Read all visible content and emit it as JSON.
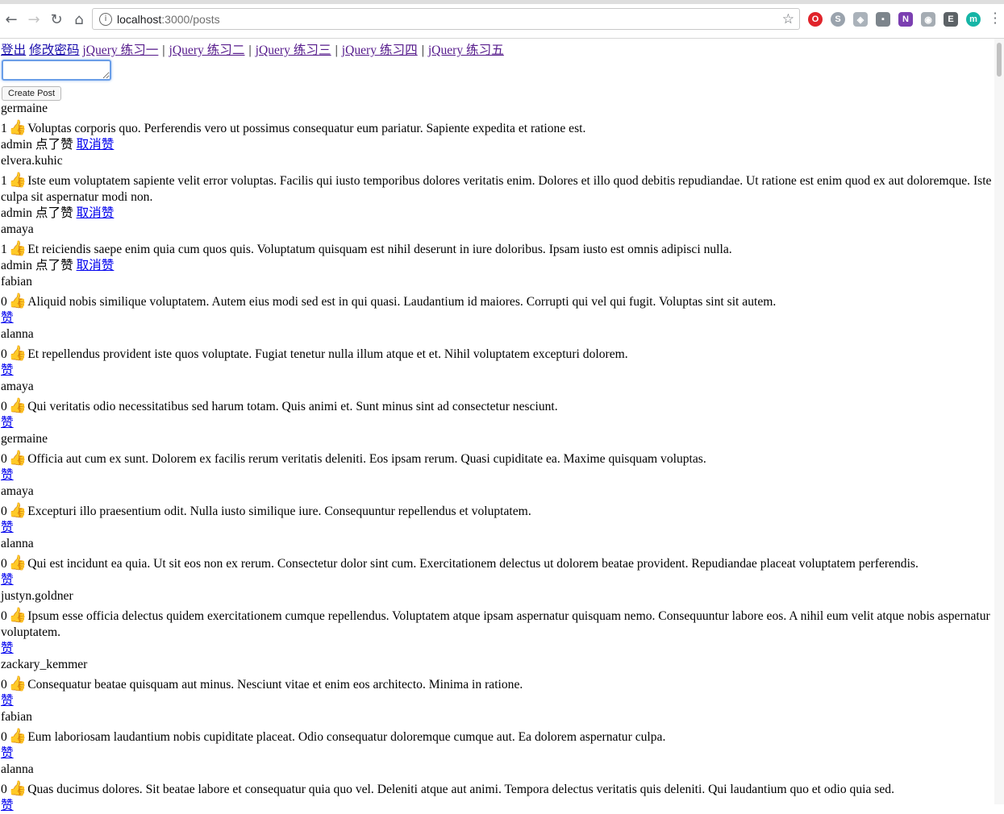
{
  "browser": {
    "url_host": "localhost",
    "url_path": ":3000/posts"
  },
  "nav": {
    "links": [
      "登出",
      "修改密码",
      "jQuery 练习一",
      "jQuery 练习二",
      "jQuery 练习三",
      "jQuery 练习四",
      "jQuery 练习五"
    ],
    "separator": "|"
  },
  "composer": {
    "textarea_value": "",
    "create_button": "Create Post"
  },
  "like_icon": "thumbs-up-icon",
  "like_glyph": "👍",
  "posts": [
    {
      "author": "germaine",
      "likes": "1",
      "body": "Voluptas corporis quo. Perferendis vero ut possimus consequatur eum pariatur. Sapiente expedita et ratione est.",
      "liked_by": "admin 点了赞",
      "action": "取消赞"
    },
    {
      "author": "elvera.kuhic",
      "likes": "1",
      "body": "Iste eum voluptatem sapiente velit error voluptas. Facilis qui iusto temporibus dolores veritatis enim. Dolores et illo quod debitis repudiandae. Ut ratione est enim quod ex aut doloremque. Iste culpa sit aspernatur modi non.",
      "liked_by": "admin 点了赞",
      "action": "取消赞"
    },
    {
      "author": "amaya",
      "likes": "1",
      "body": "Et reiciendis saepe enim quia cum quos quis. Voluptatum quisquam est nihil deserunt in iure doloribus. Ipsam iusto est omnis adipisci nulla.",
      "liked_by": "admin 点了赞",
      "action": "取消赞"
    },
    {
      "author": "fabian",
      "likes": "0",
      "body": "Aliquid nobis similique voluptatem. Autem eius modi sed est in qui quasi. Laudantium id maiores. Corrupti qui vel qui fugit. Voluptas sint sit autem.",
      "liked_by": "",
      "action": "赞"
    },
    {
      "author": "alanna",
      "likes": "0",
      "body": "Et repellendus provident iste quos voluptate. Fugiat tenetur nulla illum atque et et. Nihil voluptatem excepturi dolorem.",
      "liked_by": "",
      "action": "赞"
    },
    {
      "author": "amaya",
      "likes": "0",
      "body": "Qui veritatis odio necessitatibus sed harum totam. Quis animi et. Sunt minus sint ad consectetur nesciunt.",
      "liked_by": "",
      "action": "赞"
    },
    {
      "author": "germaine",
      "likes": "0",
      "body": "Officia aut cum ex sunt. Dolorem ex facilis rerum veritatis deleniti. Eos ipsam rerum. Quasi cupiditate ea. Maxime quisquam voluptas.",
      "liked_by": "",
      "action": "赞"
    },
    {
      "author": "amaya",
      "likes": "0",
      "body": "Excepturi illo praesentium odit. Nulla iusto similique iure. Consequuntur repellendus et voluptatem.",
      "liked_by": "",
      "action": "赞"
    },
    {
      "author": "alanna",
      "likes": "0",
      "body": "Qui est incidunt ea quia. Ut sit eos non ex rerum. Consectetur dolor sint cum. Exercitationem delectus ut dolorem beatae provident. Repudiandae placeat voluptatem perferendis.",
      "liked_by": "",
      "action": "赞"
    },
    {
      "author": "justyn.goldner",
      "likes": "0",
      "body": "Ipsum esse officia delectus quidem exercitationem cumque repellendus. Voluptatem atque ipsam aspernatur quisquam nemo. Consequuntur labore eos. A nihil eum velit atque nobis aspernatur voluptatem.",
      "liked_by": "",
      "action": "赞"
    },
    {
      "author": "zackary_kemmer",
      "likes": "0",
      "body": "Consequatur beatae quisquam aut minus. Nesciunt vitae et enim eos architecto. Minima in ratione.",
      "liked_by": "",
      "action": "赞"
    },
    {
      "author": "fabian",
      "likes": "0",
      "body": "Eum laboriosam laudantium nobis cupiditate placeat. Odio consequatur doloremque cumque aut. Ea dolorem aspernatur culpa.",
      "liked_by": "",
      "action": "赞"
    },
    {
      "author": "alanna",
      "likes": "0",
      "body": "Quas ducimus dolores. Sit beatae labore et consequatur quia quo vel. Deleniti atque aut animi. Tempora delectus veritatis quis deleniti. Qui laudantium quo et odio quia sed.",
      "liked_by": "",
      "action": "赞"
    }
  ]
}
